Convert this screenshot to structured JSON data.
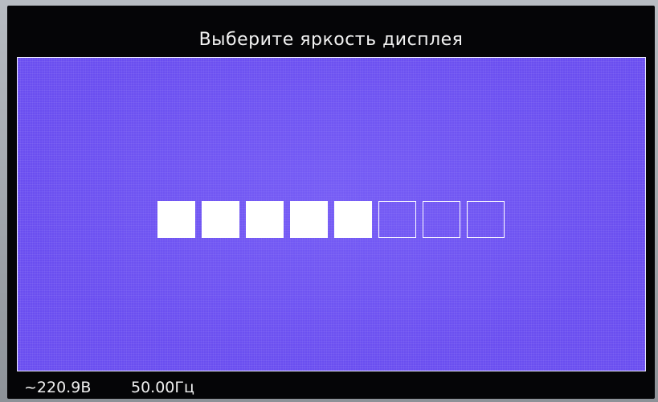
{
  "screen": {
    "title": "Выберите яркость дисплея"
  },
  "brightness": {
    "level": 5,
    "max": 8
  },
  "status": {
    "voltage": "~220.9В",
    "frequency": "50.00Гц"
  },
  "colors": {
    "panel_background": "#6a4ef0",
    "frame": "#050507",
    "segment_on": "#ffffff",
    "text": "#f2f2f2"
  }
}
